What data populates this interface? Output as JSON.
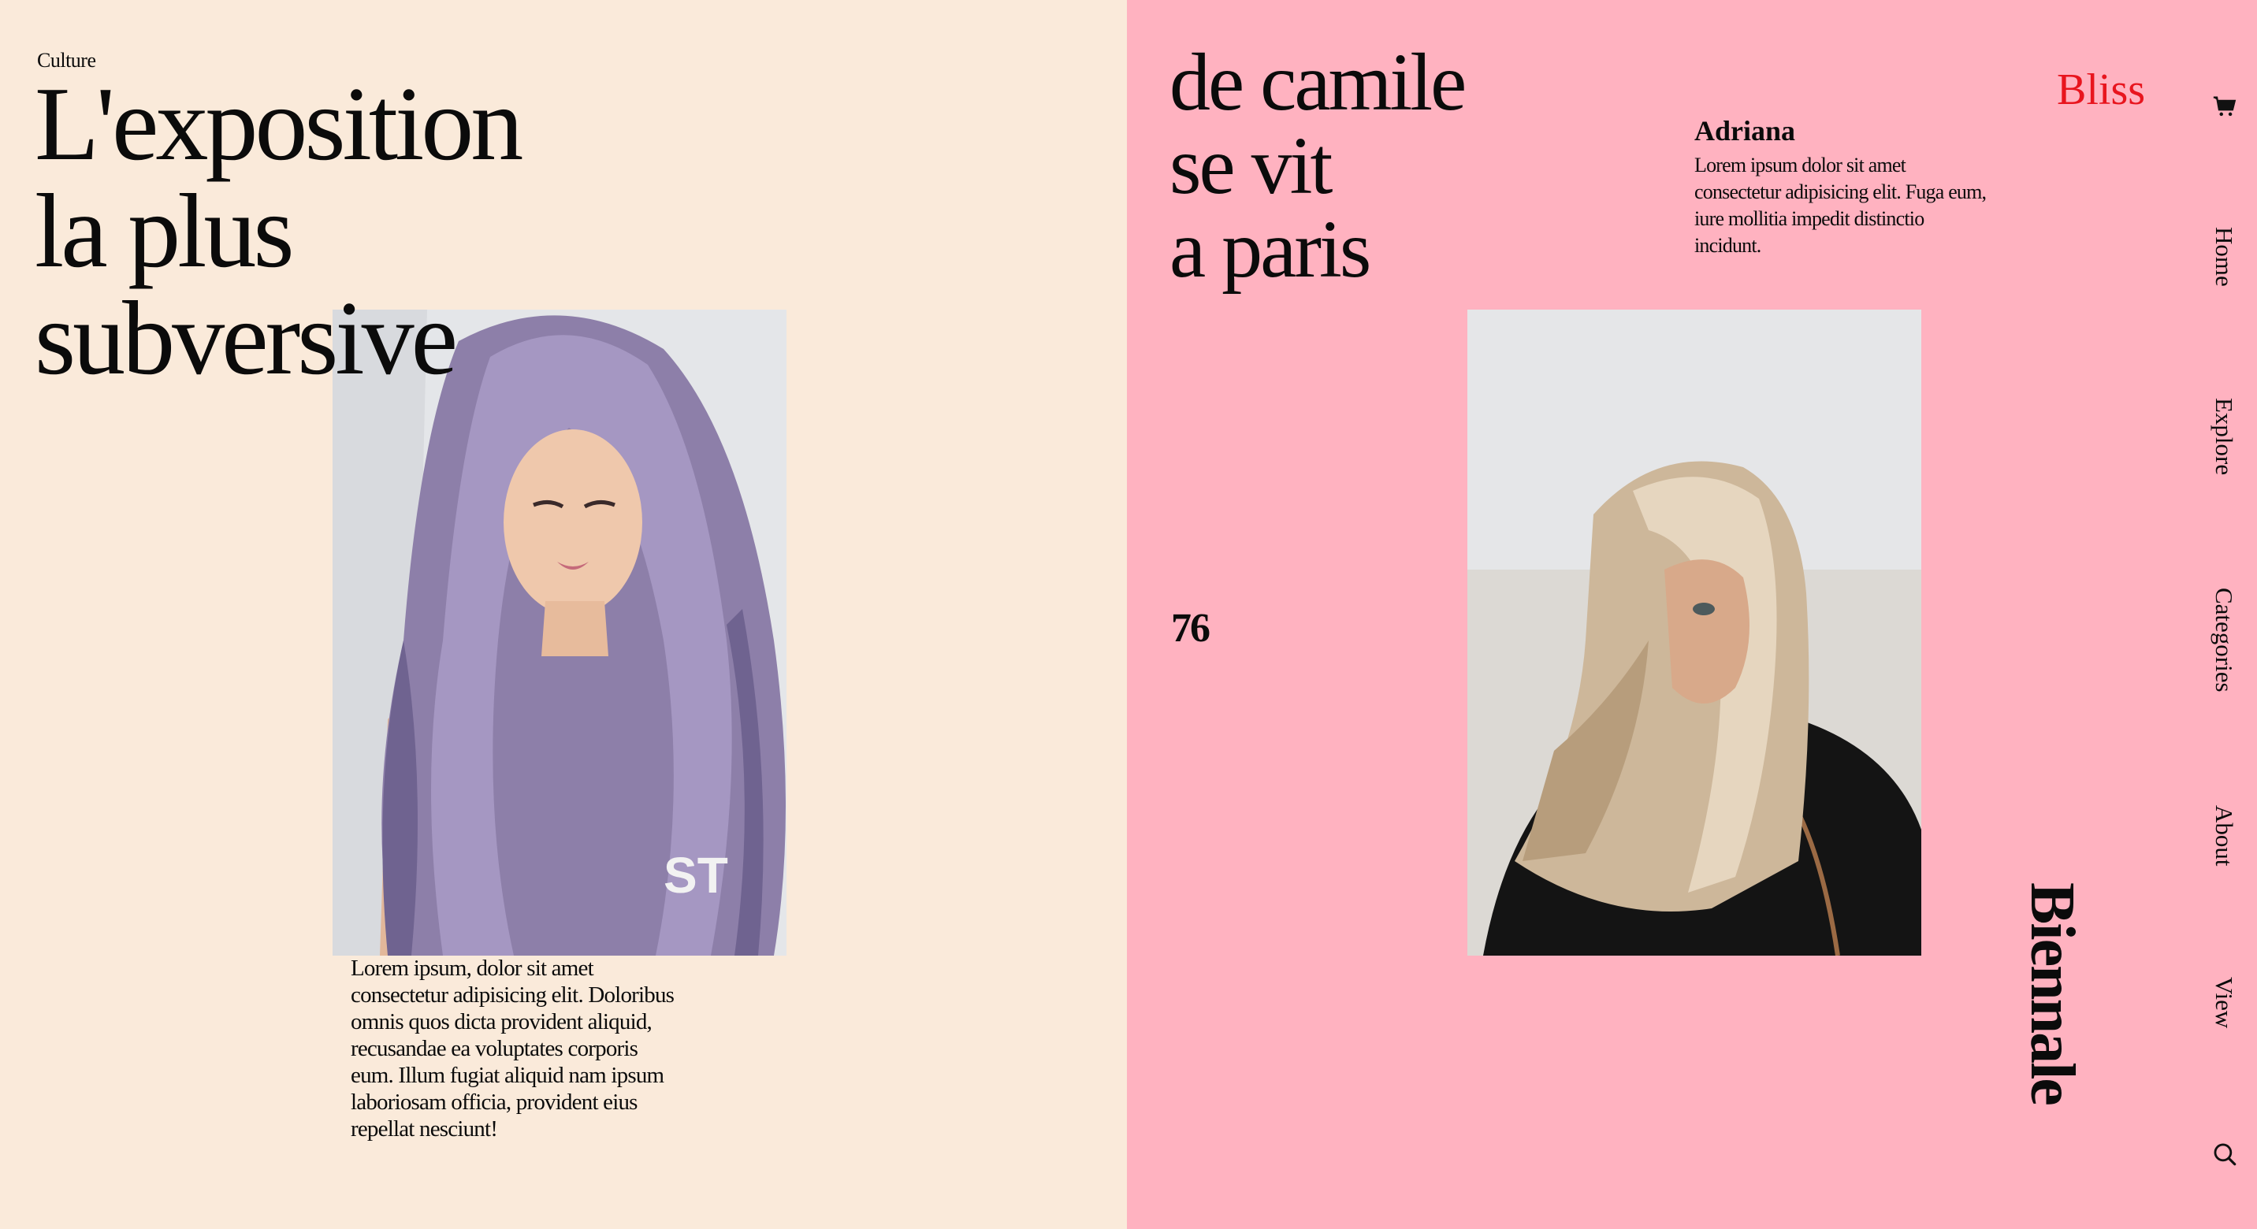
{
  "left_page": {
    "section_label": "Culture",
    "headline": [
      "L'exposition",
      "la plus",
      "subversive"
    ],
    "caption": "Lorem ipsum, dolor sit amet consectetur adipisicing elit. Doloribus omnis quos dicta provident aliquid, recusandae ea voluptates corporis eum. Illum fugiat aliquid nam ipsum laboriosam officia, provident eius repellat nesciunt!"
  },
  "right_page": {
    "headline": [
      "de camile",
      "se vit",
      "a paris"
    ],
    "author": {
      "name": "Adriana",
      "text": "Lorem ipsum dolor sit amet consectetur adipisicing elit. Fuga eum, iure mollitia impedit distinctio incidunt."
    },
    "brand": "Bliss",
    "page_number": "76",
    "vertical_title": "Biennale"
  },
  "nav": {
    "items": [
      "Home",
      "Explore",
      "Categories",
      "About",
      "View"
    ],
    "icons": [
      "cart-icon",
      "search-icon"
    ]
  },
  "colors": {
    "left_background": "#faeada",
    "right_background": "#ffb2c0",
    "brand_red": "#e8151e",
    "text": "#0b0b0b"
  }
}
